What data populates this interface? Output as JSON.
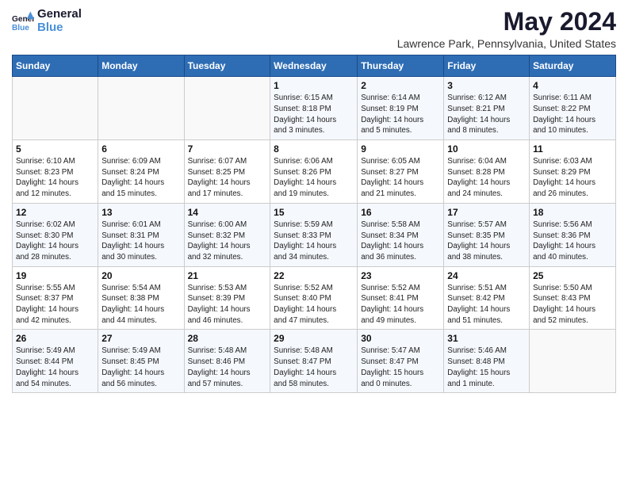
{
  "header": {
    "logo_line1": "General",
    "logo_line2": "Blue",
    "title": "May 2024",
    "subtitle": "Lawrence Park, Pennsylvania, United States"
  },
  "weekdays": [
    "Sunday",
    "Monday",
    "Tuesday",
    "Wednesday",
    "Thursday",
    "Friday",
    "Saturday"
  ],
  "weeks": [
    [
      {
        "num": "",
        "info": ""
      },
      {
        "num": "",
        "info": ""
      },
      {
        "num": "",
        "info": ""
      },
      {
        "num": "1",
        "info": "Sunrise: 6:15 AM\nSunset: 8:18 PM\nDaylight: 14 hours\nand 3 minutes."
      },
      {
        "num": "2",
        "info": "Sunrise: 6:14 AM\nSunset: 8:19 PM\nDaylight: 14 hours\nand 5 minutes."
      },
      {
        "num": "3",
        "info": "Sunrise: 6:12 AM\nSunset: 8:21 PM\nDaylight: 14 hours\nand 8 minutes."
      },
      {
        "num": "4",
        "info": "Sunrise: 6:11 AM\nSunset: 8:22 PM\nDaylight: 14 hours\nand 10 minutes."
      }
    ],
    [
      {
        "num": "5",
        "info": "Sunrise: 6:10 AM\nSunset: 8:23 PM\nDaylight: 14 hours\nand 12 minutes."
      },
      {
        "num": "6",
        "info": "Sunrise: 6:09 AM\nSunset: 8:24 PM\nDaylight: 14 hours\nand 15 minutes."
      },
      {
        "num": "7",
        "info": "Sunrise: 6:07 AM\nSunset: 8:25 PM\nDaylight: 14 hours\nand 17 minutes."
      },
      {
        "num": "8",
        "info": "Sunrise: 6:06 AM\nSunset: 8:26 PM\nDaylight: 14 hours\nand 19 minutes."
      },
      {
        "num": "9",
        "info": "Sunrise: 6:05 AM\nSunset: 8:27 PM\nDaylight: 14 hours\nand 21 minutes."
      },
      {
        "num": "10",
        "info": "Sunrise: 6:04 AM\nSunset: 8:28 PM\nDaylight: 14 hours\nand 24 minutes."
      },
      {
        "num": "11",
        "info": "Sunrise: 6:03 AM\nSunset: 8:29 PM\nDaylight: 14 hours\nand 26 minutes."
      }
    ],
    [
      {
        "num": "12",
        "info": "Sunrise: 6:02 AM\nSunset: 8:30 PM\nDaylight: 14 hours\nand 28 minutes."
      },
      {
        "num": "13",
        "info": "Sunrise: 6:01 AM\nSunset: 8:31 PM\nDaylight: 14 hours\nand 30 minutes."
      },
      {
        "num": "14",
        "info": "Sunrise: 6:00 AM\nSunset: 8:32 PM\nDaylight: 14 hours\nand 32 minutes."
      },
      {
        "num": "15",
        "info": "Sunrise: 5:59 AM\nSunset: 8:33 PM\nDaylight: 14 hours\nand 34 minutes."
      },
      {
        "num": "16",
        "info": "Sunrise: 5:58 AM\nSunset: 8:34 PM\nDaylight: 14 hours\nand 36 minutes."
      },
      {
        "num": "17",
        "info": "Sunrise: 5:57 AM\nSunset: 8:35 PM\nDaylight: 14 hours\nand 38 minutes."
      },
      {
        "num": "18",
        "info": "Sunrise: 5:56 AM\nSunset: 8:36 PM\nDaylight: 14 hours\nand 40 minutes."
      }
    ],
    [
      {
        "num": "19",
        "info": "Sunrise: 5:55 AM\nSunset: 8:37 PM\nDaylight: 14 hours\nand 42 minutes."
      },
      {
        "num": "20",
        "info": "Sunrise: 5:54 AM\nSunset: 8:38 PM\nDaylight: 14 hours\nand 44 minutes."
      },
      {
        "num": "21",
        "info": "Sunrise: 5:53 AM\nSunset: 8:39 PM\nDaylight: 14 hours\nand 46 minutes."
      },
      {
        "num": "22",
        "info": "Sunrise: 5:52 AM\nSunset: 8:40 PM\nDaylight: 14 hours\nand 47 minutes."
      },
      {
        "num": "23",
        "info": "Sunrise: 5:52 AM\nSunset: 8:41 PM\nDaylight: 14 hours\nand 49 minutes."
      },
      {
        "num": "24",
        "info": "Sunrise: 5:51 AM\nSunset: 8:42 PM\nDaylight: 14 hours\nand 51 minutes."
      },
      {
        "num": "25",
        "info": "Sunrise: 5:50 AM\nSunset: 8:43 PM\nDaylight: 14 hours\nand 52 minutes."
      }
    ],
    [
      {
        "num": "26",
        "info": "Sunrise: 5:49 AM\nSunset: 8:44 PM\nDaylight: 14 hours\nand 54 minutes."
      },
      {
        "num": "27",
        "info": "Sunrise: 5:49 AM\nSunset: 8:45 PM\nDaylight: 14 hours\nand 56 minutes."
      },
      {
        "num": "28",
        "info": "Sunrise: 5:48 AM\nSunset: 8:46 PM\nDaylight: 14 hours\nand 57 minutes."
      },
      {
        "num": "29",
        "info": "Sunrise: 5:48 AM\nSunset: 8:47 PM\nDaylight: 14 hours\nand 58 minutes."
      },
      {
        "num": "30",
        "info": "Sunrise: 5:47 AM\nSunset: 8:47 PM\nDaylight: 15 hours\nand 0 minutes."
      },
      {
        "num": "31",
        "info": "Sunrise: 5:46 AM\nSunset: 8:48 PM\nDaylight: 15 hours\nand 1 minute."
      },
      {
        "num": "",
        "info": ""
      }
    ]
  ],
  "colors": {
    "header_bg": "#2e6db4",
    "accent": "#4a90d9"
  }
}
